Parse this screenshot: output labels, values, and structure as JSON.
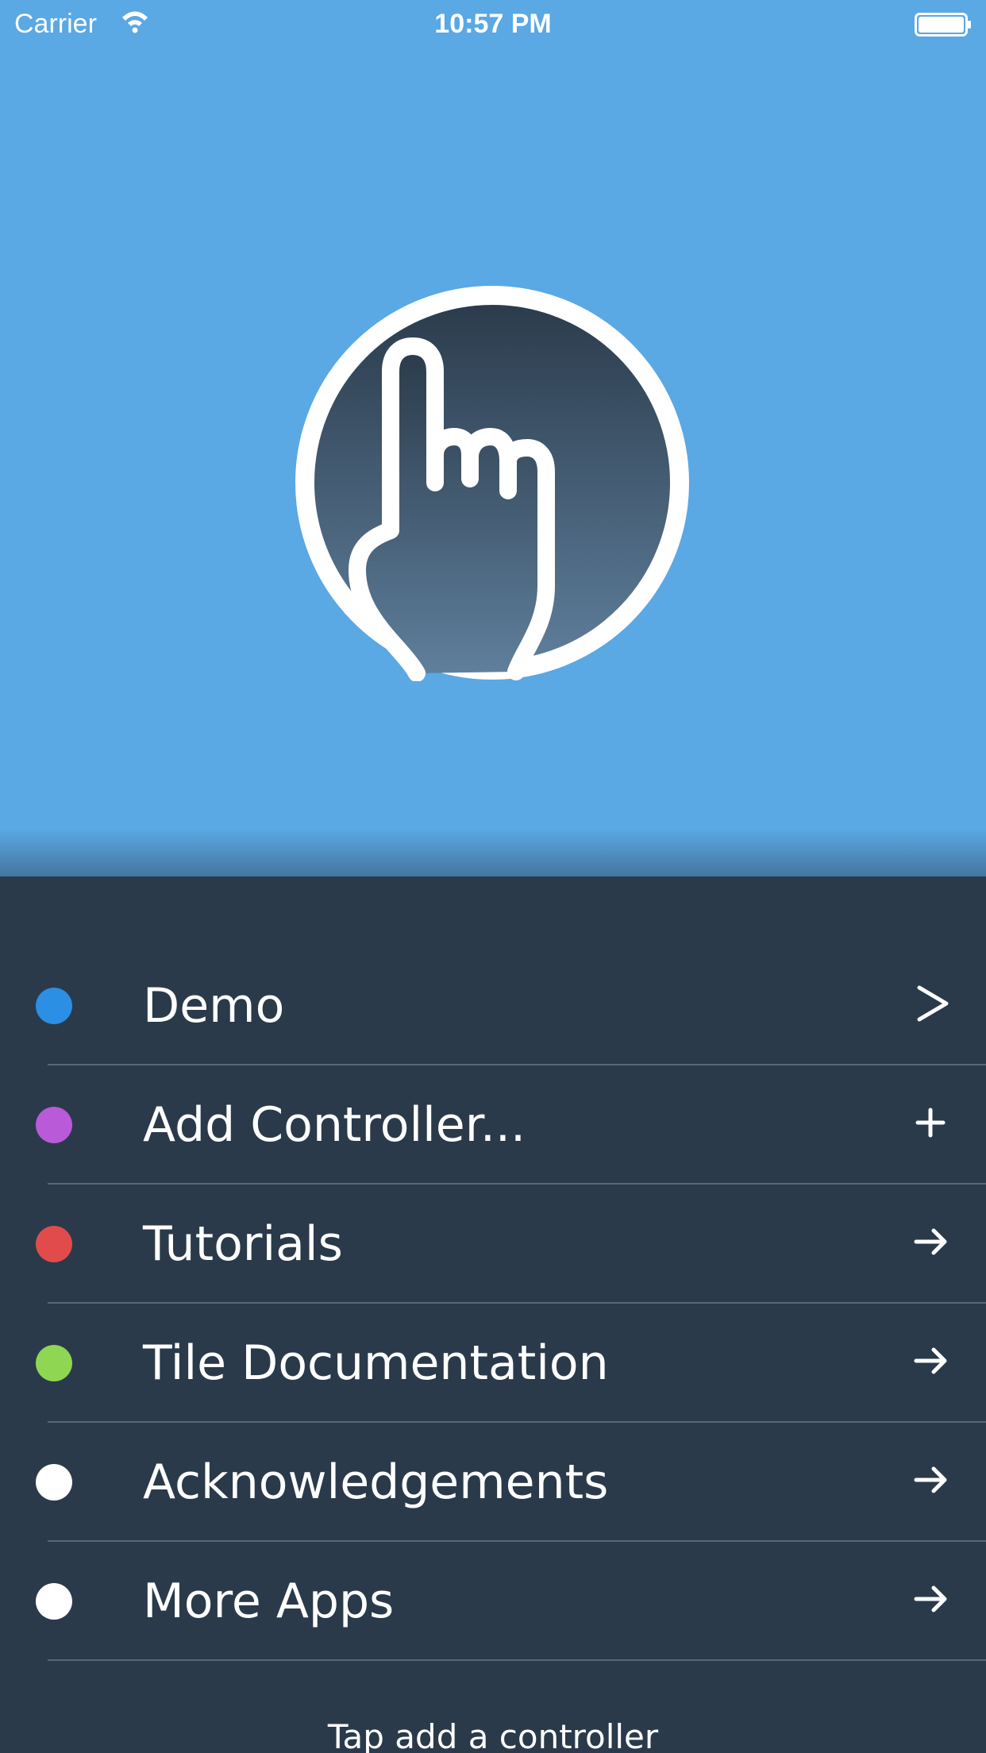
{
  "status_bar": {
    "carrier": "Carrier",
    "time": "10:57 PM",
    "wifi_icon": "wifi-icon",
    "battery_icon": "battery-full-icon"
  },
  "hero": {
    "background": "#5aa8e4",
    "logo_icon": "pointing-hand-icon"
  },
  "menu": {
    "background": "#2a3a4a",
    "items": [
      {
        "label": "Demo",
        "dot_color": "#2b8fe3",
        "action_icon": "chevron-right-icon"
      },
      {
        "label": "Add Controller...",
        "dot_color": "#b95ad8",
        "action_icon": "plus-icon"
      },
      {
        "label": "Tutorials",
        "dot_color": "#e24b4b",
        "action_icon": "arrow-right-icon"
      },
      {
        "label": "Tile Documentation",
        "dot_color": "#8fd652",
        "action_icon": "arrow-right-icon"
      },
      {
        "label": "Acknowledgements",
        "dot_color": "#ffffff",
        "action_icon": "arrow-right-icon"
      },
      {
        "label": "More Apps",
        "dot_color": "#ffffff",
        "action_icon": "arrow-right-icon"
      }
    ]
  },
  "footer": {
    "hint": "Tap add a controller"
  }
}
